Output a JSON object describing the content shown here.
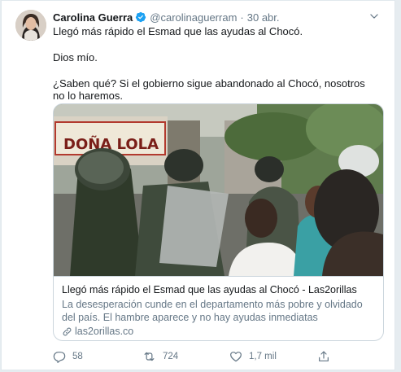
{
  "tweet": {
    "author_name": "Carolina Guerra",
    "author_handle": "@carolinaguerram",
    "separator": "·",
    "timestamp": "30 abr.",
    "paragraphs": [
      "Llegó más rápido el Esmad que las ayudas al Chocó.",
      "Dios mío.",
      "¿Saben qué? Si el gobierno sigue abandonado al Chocó, nosotros no lo haremos."
    ]
  },
  "card": {
    "title": "Llegó más rápido el Esmad que las ayudas al Chocó - Las2orillas",
    "description": "La desesperación cunde en el departamento más pobre y olvidado del país. El hambre aparece y no hay ayudas inmediatas",
    "domain": "las2orillas.co",
    "image_sign_text": "DOÑA LOLA"
  },
  "actions": {
    "replies": "58",
    "retweets": "724",
    "likes": "1,7 mil"
  },
  "colors": {
    "text_primary": "#14171a",
    "text_secondary": "#657786",
    "verified_blue": "#1da1f2",
    "border": "#ccd6dd"
  }
}
